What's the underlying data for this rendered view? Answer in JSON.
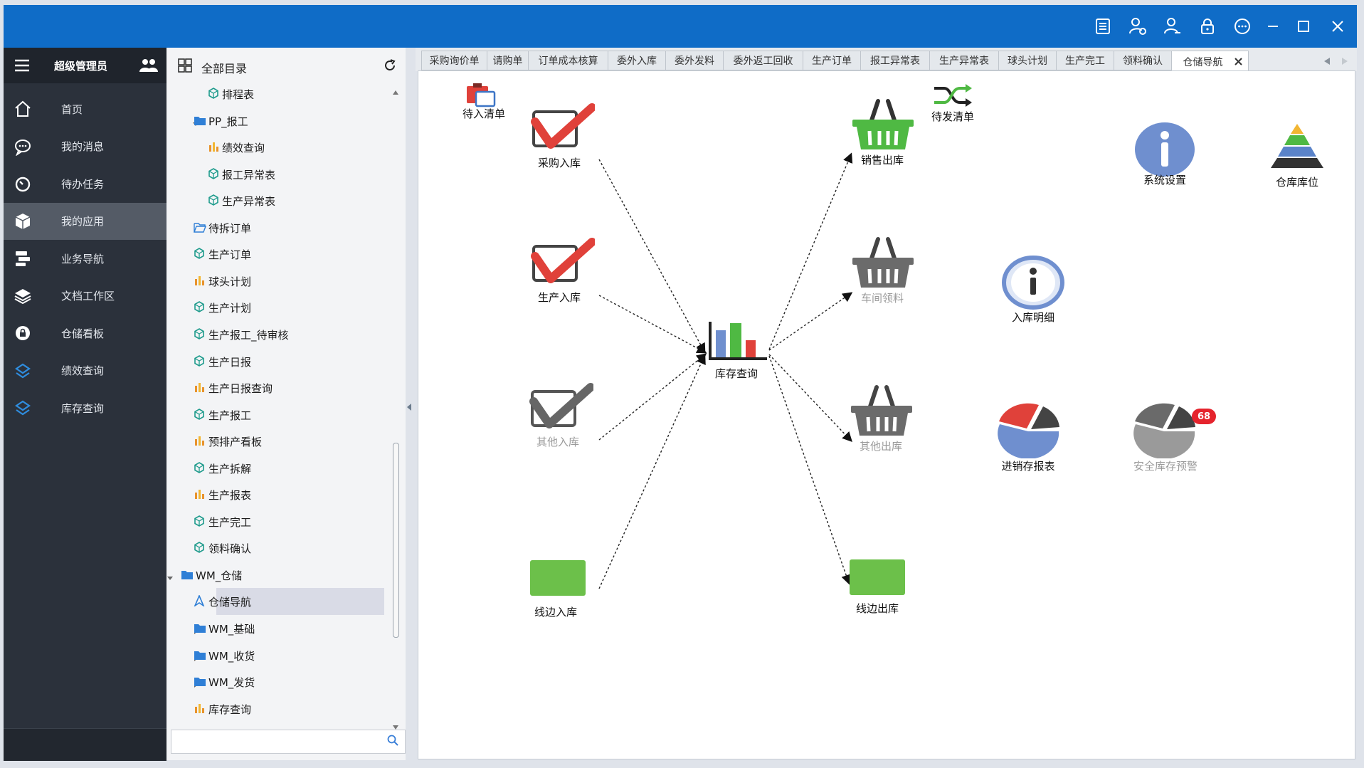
{
  "sidebar": {
    "user_name": "超级管理员",
    "items": [
      {
        "label": "首页",
        "icon": "home-icon"
      },
      {
        "label": "我的消息",
        "icon": "message-icon"
      },
      {
        "label": "待办任务",
        "icon": "timer-icon"
      },
      {
        "label": "我的应用",
        "icon": "cube-icon",
        "active": true
      },
      {
        "label": "业务导航",
        "icon": "flow-icon"
      },
      {
        "label": "文档工作区",
        "icon": "layers-icon"
      },
      {
        "label": "仓储看板",
        "icon": "lock-badge-icon"
      },
      {
        "label": "绩效查询",
        "icon": "sync-icon"
      },
      {
        "label": "库存查询",
        "icon": "sync-icon"
      }
    ]
  },
  "tree": {
    "title": "全部目录",
    "search_placeholder": "",
    "items": [
      {
        "label": "排程表",
        "icon": "cube-outline-icon"
      },
      {
        "label": "PP_报工",
        "icon": "folder-icon"
      },
      {
        "label": "绩效查询",
        "icon": "bar-chart-icon"
      },
      {
        "label": "报工异常表",
        "icon": "cube-outline-icon"
      },
      {
        "label": "生产异常表",
        "icon": "cube-outline-icon"
      },
      {
        "label": "待拆订单",
        "icon": "folder-open-icon"
      },
      {
        "label": "生产订单",
        "icon": "cube-outline-icon"
      },
      {
        "label": "球头计划",
        "icon": "bar-chart-icon"
      },
      {
        "label": "生产计划",
        "icon": "cube-outline-icon"
      },
      {
        "label": "生产报工_待审核",
        "icon": "cube-outline-icon"
      },
      {
        "label": "生产日报",
        "icon": "cube-outline-icon"
      },
      {
        "label": "生产日报查询",
        "icon": "bar-chart-icon"
      },
      {
        "label": "生产报工",
        "icon": "cube-outline-icon"
      },
      {
        "label": "预排产看板",
        "icon": "bar-chart-icon"
      },
      {
        "label": "生产拆解",
        "icon": "cube-outline-icon"
      },
      {
        "label": "生产报表",
        "icon": "bar-chart-icon"
      },
      {
        "label": "生产完工",
        "icon": "cube-outline-icon"
      },
      {
        "label": "领料确认",
        "icon": "cube-outline-icon"
      },
      {
        "label": "WM_仓储",
        "icon": "folder-icon"
      },
      {
        "label": "仓储导航",
        "icon": "navigation-icon"
      },
      {
        "label": "WM_基础",
        "icon": "folder-icon"
      },
      {
        "label": "WM_收货",
        "icon": "folder-icon"
      },
      {
        "label": "WM_发货",
        "icon": "folder-icon"
      },
      {
        "label": "库存查询",
        "icon": "bar-chart-icon"
      }
    ]
  },
  "tabs": [
    "采购询价单",
    "请购单",
    "订单成本核算",
    "委外入库",
    "委外发料",
    "委外返工回收",
    "生产订单",
    "报工异常表",
    "生产异常表",
    "球头计划",
    "生产完工",
    "领料确认",
    "仓储导航"
  ],
  "active_tab": "仓储导航",
  "nav": {
    "pending_in": "待入清单",
    "pending_out": "待发清单",
    "purchase_in": "采购入库",
    "production_in": "生产入库",
    "other_in": "其他入库",
    "line_in": "线边入库",
    "stock_query": "库存查询",
    "sales_out": "销售出库",
    "workshop_pick": "车间领料",
    "other_out": "其他出库",
    "line_out": "线边出库",
    "system_settings": "系统设置",
    "warehouse_location": "仓库库位",
    "inbound_detail": "入库明细",
    "inventory_report": "进销存报表",
    "safety_stock_alert": "安全库存预警",
    "alert_count": "68"
  },
  "colors": {
    "titlebar": "#0f6cc7",
    "nav_bg": "#2b313b",
    "check_red": "#e0413a",
    "basket_green": "#4fb943",
    "line_green": "#6cc04a",
    "info_blue": "#6f8fcf",
    "badge_red": "#e5242d"
  }
}
